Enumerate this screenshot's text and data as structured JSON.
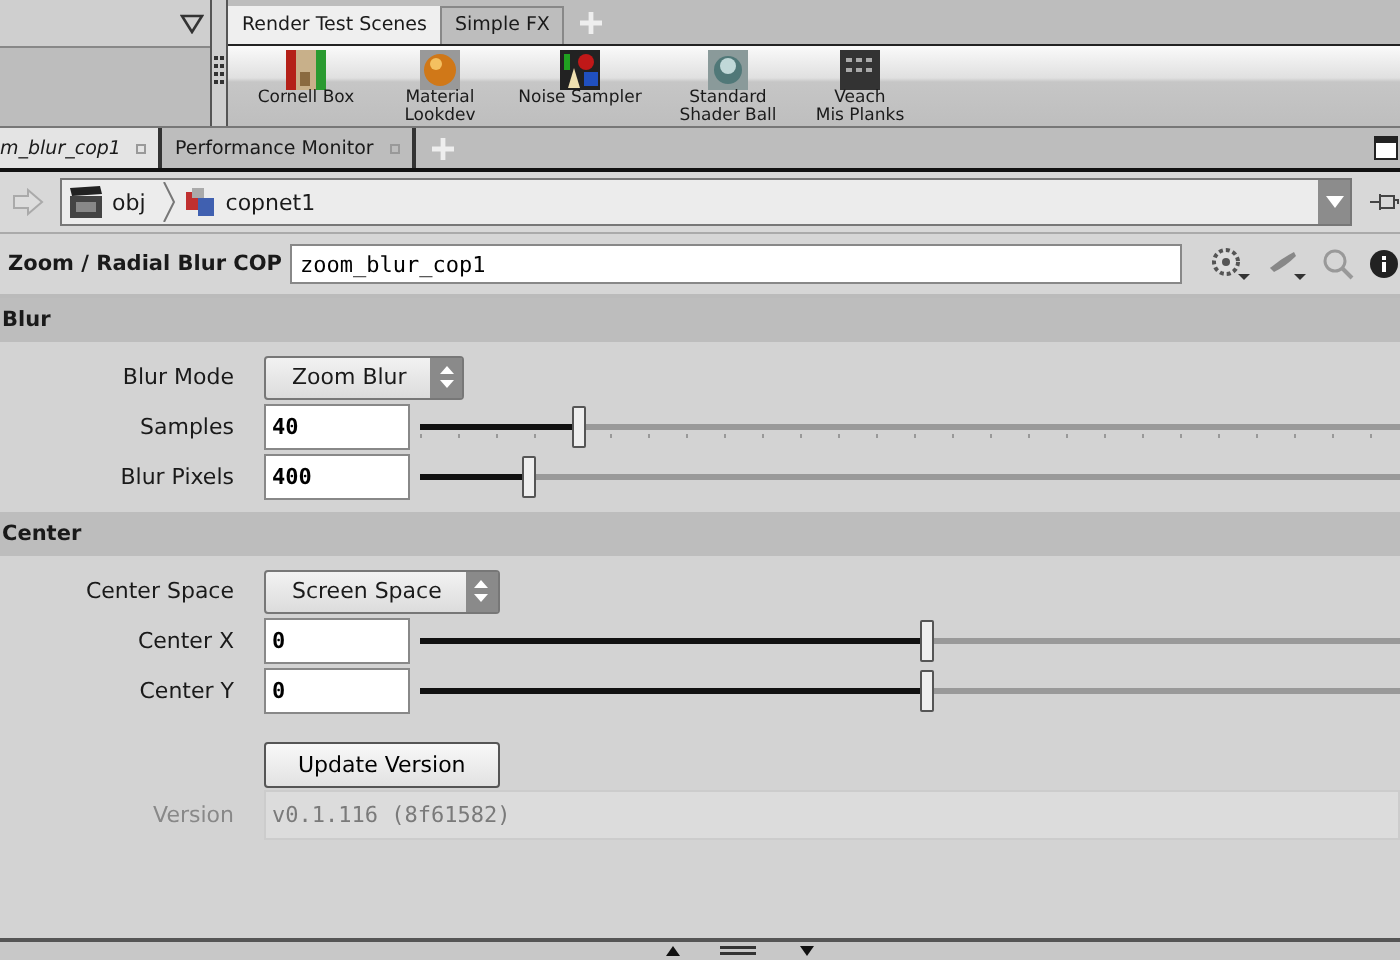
{
  "shelf": {
    "tabs": [
      {
        "label": "Render Test Scenes",
        "selected": true
      },
      {
        "label": "Simple FX",
        "selected": false
      }
    ],
    "tools": [
      {
        "label": "Cornell Box",
        "kind": "room"
      },
      {
        "label": "Material\nLookdev",
        "kind": "sphere"
      },
      {
        "label": "Noise Sampler",
        "kind": "shapes"
      },
      {
        "label": "Standard\nShader Ball",
        "kind": "ball"
      },
      {
        "label": "Veach\nMis Planks",
        "kind": "grid"
      }
    ]
  },
  "pane_tabs": [
    {
      "label": "m_blur_cop1",
      "selected": true
    },
    {
      "label": "Performance Monitor",
      "selected": false
    }
  ],
  "path": [
    {
      "label": "obj",
      "kind": "scene"
    },
    {
      "label": "copnet1",
      "kind": "network"
    }
  ],
  "node": {
    "type": "Zoom / Radial Blur COP",
    "name": "zoom_blur_cop1"
  },
  "sections": [
    {
      "title": "Blur",
      "params": [
        {
          "kind": "menu",
          "label": "Blur Mode",
          "value": "Zoom Blur"
        },
        {
          "kind": "slider",
          "label": "Samples",
          "value": "40",
          "level": 0.157,
          "ticks": true
        },
        {
          "kind": "slider",
          "label": "Blur Pixels",
          "value": "400",
          "level": 0.108,
          "ticks": false
        }
      ]
    },
    {
      "title": "Center",
      "params": [
        {
          "kind": "menu",
          "label": "Center Space",
          "value": "Screen Space"
        },
        {
          "kind": "slider",
          "label": "Center X",
          "value": "0",
          "level": 0.506,
          "ticks": false
        },
        {
          "kind": "slider",
          "label": "Center Y",
          "value": "0",
          "level": 0.506,
          "ticks": false
        }
      ]
    }
  ],
  "footer_params": [
    {
      "kind": "button",
      "label": "Update Version"
    },
    {
      "kind": "readonly",
      "label": "Version",
      "value": "v0.1.116 (8f61582)",
      "disabled": true
    }
  ]
}
